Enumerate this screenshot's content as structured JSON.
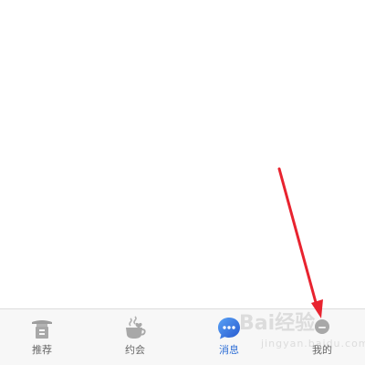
{
  "tabbar": {
    "tabs": [
      {
        "label": "推荐",
        "icon": "temple-icon",
        "active": false
      },
      {
        "label": "约会",
        "icon": "coffee-cup-icon",
        "active": false
      },
      {
        "label": "消息",
        "icon": "chat-bubble-icon",
        "active": true
      },
      {
        "label": "我的",
        "icon": "person-icon",
        "active": false
      }
    ]
  },
  "watermark": {
    "text": "Bai经验",
    "sub": "jingyan.baidu.com"
  },
  "colors": {
    "active": "#2f6fd6",
    "inactive": "#9e9e9e",
    "annotation_arrow": "#e8232f"
  }
}
